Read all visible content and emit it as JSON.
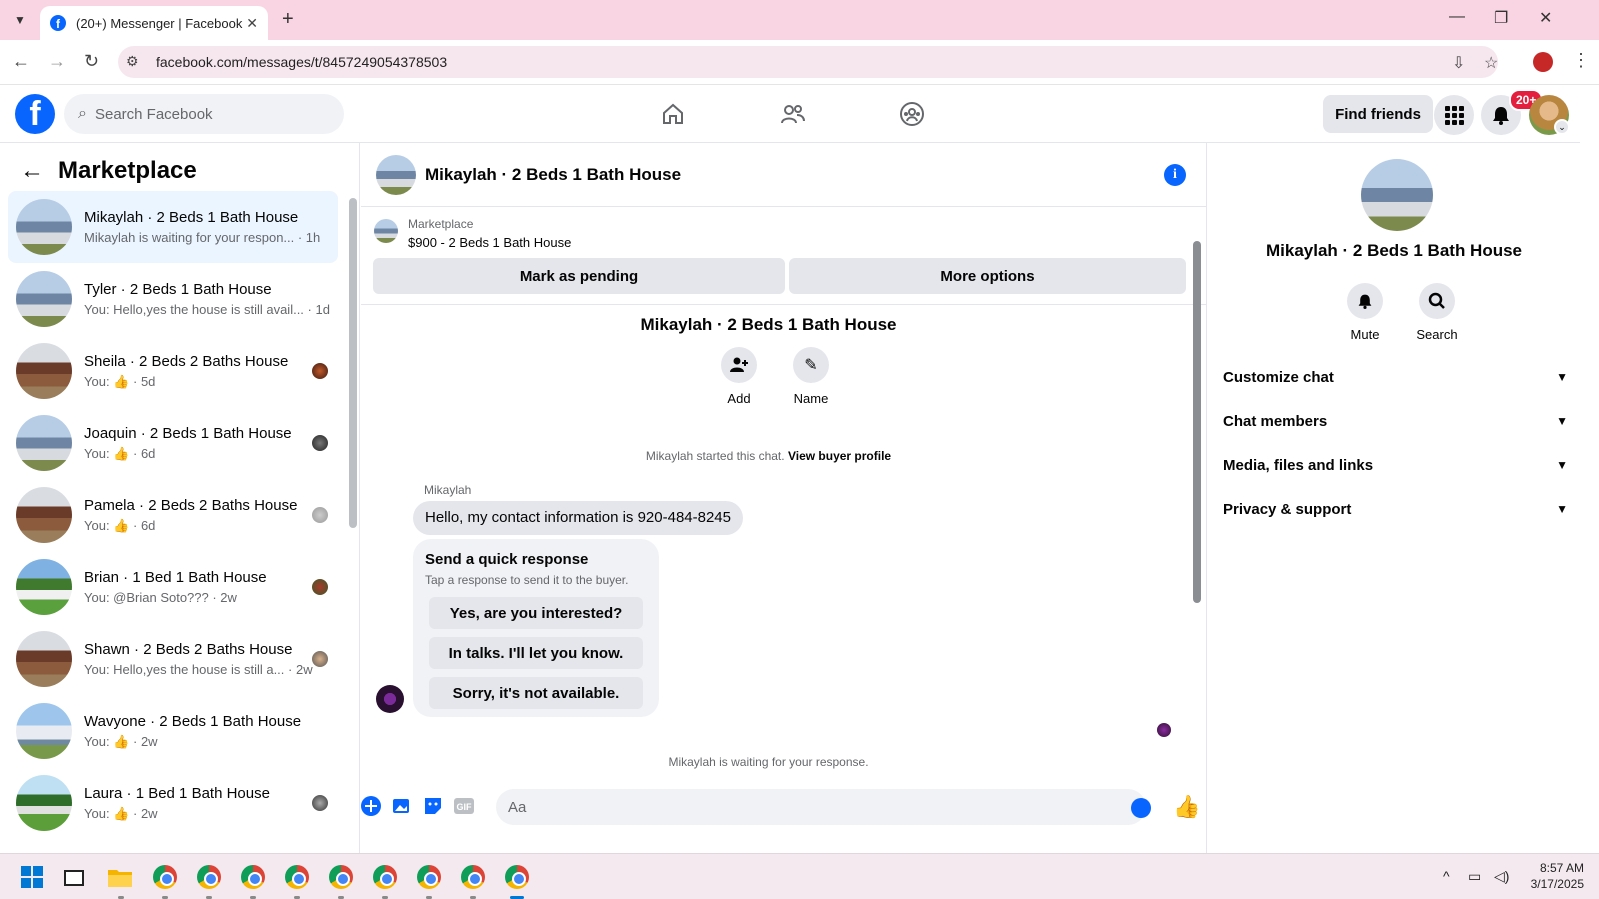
{
  "browser": {
    "tab_title": "(20+) Messenger | Facebook",
    "url": "facebook.com/messages/t/8457249054378503"
  },
  "fbnav": {
    "search_placeholder": "Search Facebook",
    "find_friends": "Find friends",
    "notification_badge": "20+"
  },
  "sidebar": {
    "title": "Marketplace",
    "conversations": [
      {
        "name": "Mikaylah · 2 Beds 1 Bath House",
        "preview": "Mikaylah is waiting for your respon... · 1h",
        "active": true
      },
      {
        "name": "Tyler · 2 Beds 1 Bath House",
        "preview": "You: Hello,yes the house is still avail... · 1d"
      },
      {
        "name": "Sheila · 2 Beds 2 Baths House",
        "preview_prefix": "You:",
        "preview_suffix": "· 5d"
      },
      {
        "name": "Joaquin · 2 Beds 1 Bath House",
        "preview_prefix": "You:",
        "preview_suffix": "· 6d"
      },
      {
        "name": "Pamela · 2 Beds 2 Baths House",
        "preview_prefix": "You:",
        "preview_suffix": "· 6d"
      },
      {
        "name": "Brian · 1 Bed 1 Bath House",
        "preview": "You: @Brian Soto??? · 2w"
      },
      {
        "name": "Shawn · 2 Beds 2 Baths House",
        "preview": "You: Hello,yes the house is still a... · 2w"
      },
      {
        "name": "Wavyone · 2 Beds 1 Bath House",
        "preview_prefix": "You:",
        "preview_suffix": "· 2w"
      },
      {
        "name": "Laura · 1 Bed 1 Bath House",
        "preview_prefix": "You:",
        "preview_suffix": "· 2w"
      }
    ]
  },
  "chat": {
    "title": "Mikaylah · 2 Beds 1 Bath House",
    "listing_label": "Marketplace",
    "listing_price": "$900 - 2 Beds 1 Bath House",
    "mark_pending": "Mark as pending",
    "more_options": "More options",
    "intro_title": "Mikaylah · 2 Beds 1 Bath House",
    "add_label": "Add",
    "name_label": "Name",
    "started_text": "Mikaylah started this chat.",
    "view_buyer": "View buyer profile",
    "sender": "Mikaylah",
    "message": "Hello, my contact information is 920-484-8245",
    "quick_title": "Send a quick response",
    "quick_sub": "Tap a response to send it to the buyer.",
    "quick_options": [
      "Yes, are you interested?",
      "In talks. I'll let you know.",
      "Sorry, it's not available."
    ],
    "waiting": "Mikaylah is waiting for your response.",
    "compose_placeholder": "Aa"
  },
  "details": {
    "name": "Mikaylah · 2 Beds 1 Bath House",
    "mute": "Mute",
    "search": "Search",
    "sections": [
      "Customize chat",
      "Chat members",
      "Media, files and links",
      "Privacy & support"
    ]
  },
  "taskbar": {
    "time": "8:57 AM",
    "date": "3/17/2025"
  },
  "colors": {
    "fb_blue": "#0866ff",
    "active_row": "#ebf5ff",
    "tab_bar": "#f9d5e3"
  }
}
